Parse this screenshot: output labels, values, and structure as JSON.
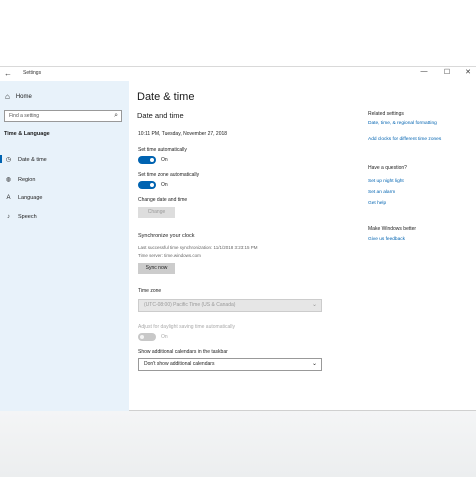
{
  "window": {
    "title": "Settings",
    "controls": [
      "—",
      "☐",
      "✕"
    ]
  },
  "sidebar": {
    "home_label": "Home",
    "search_placeholder": "Find a setting",
    "section_title": "Time & Language",
    "items": [
      {
        "label": "Date & time",
        "icon": "clock-icon"
      },
      {
        "label": "Region",
        "icon": "globe-icon"
      },
      {
        "label": "Language",
        "icon": "language-icon"
      },
      {
        "label": "Speech",
        "icon": "microphone-icon"
      }
    ]
  },
  "main": {
    "page_title": "Date & time",
    "subtitle": "Date and time",
    "current_datetime": "10:11 PM, Tuesday, November 27, 2018",
    "set_time_auto": {
      "label": "Set time automatically",
      "state": "On"
    },
    "set_zone_auto": {
      "label": "Set time zone automatically",
      "state": "On"
    },
    "change_datetime": {
      "label": "Change date and time",
      "button": "Change"
    },
    "sync": {
      "heading": "Synchronize your clock",
      "last_sync": "Last successful time synchronization: 11/1/2018 3:23:15 PM",
      "server": "Time server: time.windows.com",
      "button": "Sync now"
    },
    "time_zone": {
      "label": "Time zone",
      "value": "(UTC-08:00) Pacific Time (US & Canada)"
    },
    "dst": {
      "label": "Adjust for daylight saving time automatically",
      "state": "On"
    },
    "calendars": {
      "label": "Show additional calendars in the taskbar",
      "value": "Don't show additional calendars"
    }
  },
  "right": {
    "related_heading": "Related settings",
    "related_links": [
      "Date, time, & regional formatting",
      "Add clocks for different time zones"
    ],
    "question_heading": "Have a question?",
    "question_links": [
      "Set up night light",
      "Set an alarm",
      "Get help"
    ],
    "better_heading": "Make Windows better",
    "better_links": [
      "Give us feedback"
    ]
  },
  "colors": {
    "accent": "#0063b1",
    "sidebar_bg": "#e8f2fa"
  }
}
